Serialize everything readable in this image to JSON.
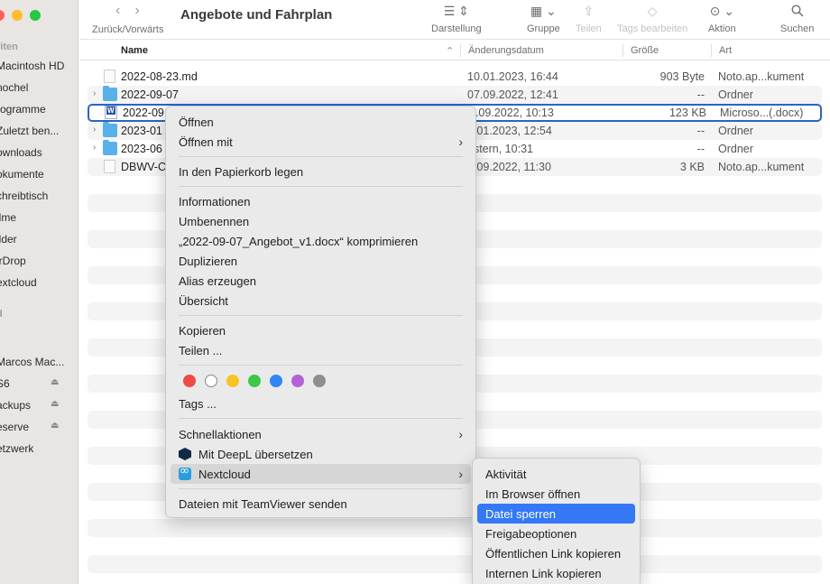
{
  "window": {
    "title": "Angebote und Fahrplan"
  },
  "toolbar": {
    "nav_label": "Zurück/Vorwärts",
    "items": [
      {
        "label": "Darstellung",
        "icon": "list-view-icon"
      },
      {
        "label": "Gruppe",
        "icon": "group-grid-icon"
      },
      {
        "label": "Teilen",
        "icon": "share-icon"
      },
      {
        "label": "Tags bearbeiten",
        "icon": "tag-icon"
      },
      {
        "label": "Aktion",
        "icon": "ellipsis-circle-icon"
      },
      {
        "label": "Suchen",
        "icon": "search-icon"
      }
    ]
  },
  "sidebar": {
    "sections": [
      "riten",
      "d"
    ],
    "items": [
      {
        "label": "Macintosh HD"
      },
      {
        "label": "nochel"
      },
      {
        "label": "rogramme"
      },
      {
        "label": "Zuletzt ben..."
      },
      {
        "label": "ownloads"
      },
      {
        "label": "okumente"
      },
      {
        "label": "chreibtisch"
      },
      {
        "label": "ilme"
      },
      {
        "label": "ilder"
      },
      {
        "label": "irDrop"
      },
      {
        "label": "extcloud"
      },
      {
        "label": "Marcos Mac..."
      },
      {
        "label": "S6"
      },
      {
        "label": "ackups"
      },
      {
        "label": "eserve"
      },
      {
        "label": "etzwerk"
      }
    ]
  },
  "columns": {
    "name": "Name",
    "date": "Änderungsdatum",
    "size": "Größe",
    "kind": "Art"
  },
  "files": [
    {
      "name": "2022-08-23.md",
      "date": "10.01.2023, 16:44",
      "size": "903 Byte",
      "kind": "Noto.ap...kument",
      "type": "doc"
    },
    {
      "name": "2022-09-07",
      "date": "07.09.2022, 12:41",
      "size": "--",
      "kind": "Ordner",
      "type": "folder"
    },
    {
      "name": "2022-09",
      "date": "7.09.2022, 10:13",
      "size": "123 KB",
      "kind": "Microso...(.docx)",
      "type": "word"
    },
    {
      "name": "2023-01",
      "date": "3.01.2023, 12:54",
      "size": "--",
      "kind": "Ordner",
      "type": "folder"
    },
    {
      "name": "2023-06",
      "date": "estern, 10:31",
      "size": "--",
      "kind": "Ordner",
      "type": "folder"
    },
    {
      "name": "DBWV-C",
      "date": "7.09.2022, 11:30",
      "size": "3 KB",
      "kind": "Noto.ap...kument",
      "type": "doc"
    }
  ],
  "context_menu": {
    "items": [
      "Öffnen",
      "Öffnen mit",
      "In den Papierkorb legen",
      "Informationen",
      "Umbenennen",
      "„2022-09-07_Angebot_v1.docx“ komprimieren",
      "Duplizieren",
      "Alias erzeugen",
      "Übersicht",
      "Kopieren",
      "Teilen ...",
      "Tags ...",
      "Schnellaktionen",
      "Mit DeepL übersetzen",
      "Nextcloud",
      "Dateien mit TeamViewer senden"
    ],
    "tag_colors": [
      "#f04a45",
      "#ffffff",
      "#f8c323",
      "#3ec648",
      "#2f86f6",
      "#b461d6",
      "#8e8e93"
    ]
  },
  "submenu": {
    "items": [
      "Aktivität",
      "Im Browser öffnen",
      "Datei sperren",
      "Freigabeoptionen",
      "Öffentlichen Link kopieren",
      "Internen Link kopieren"
    ]
  }
}
